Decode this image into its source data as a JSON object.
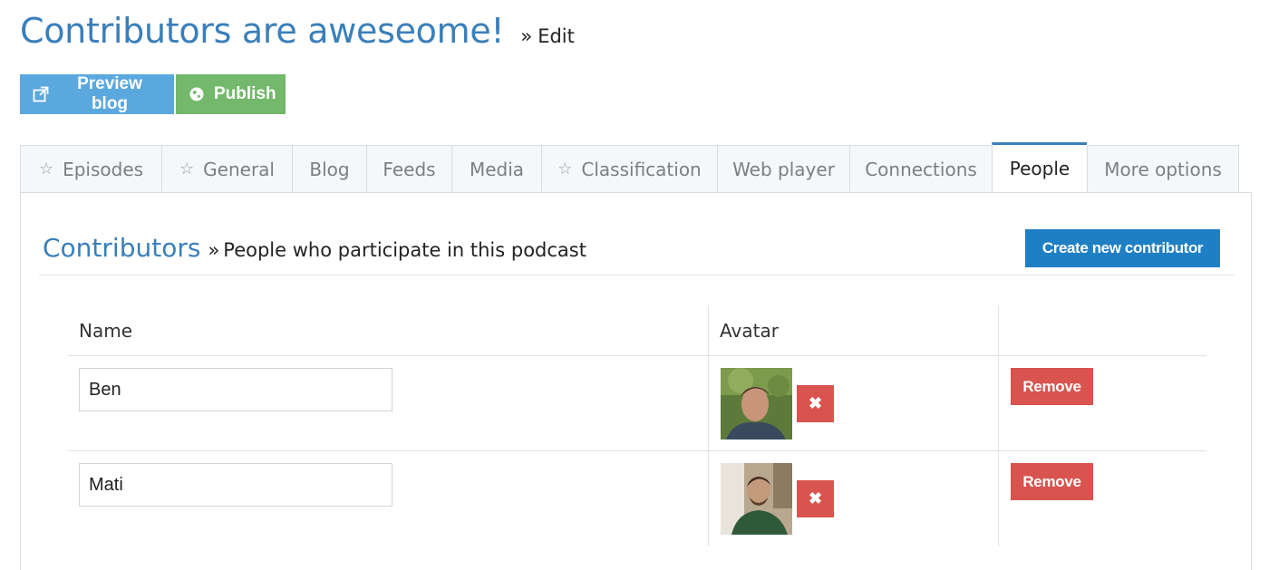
{
  "header": {
    "title": "Contributors are aweseome!",
    "separator": "»",
    "edit_label": "Edit"
  },
  "actions": {
    "preview_label": "Preview blog",
    "publish_label": "Publish"
  },
  "tabs": [
    {
      "label": "Episodes",
      "starred": true,
      "active": false
    },
    {
      "label": "General",
      "starred": true,
      "active": false
    },
    {
      "label": "Blog",
      "starred": false,
      "active": false
    },
    {
      "label": "Feeds",
      "starred": false,
      "active": false
    },
    {
      "label": "Media",
      "starred": false,
      "active": false
    },
    {
      "label": "Classification",
      "starred": true,
      "active": false
    },
    {
      "label": "Web player",
      "starred": false,
      "active": false
    },
    {
      "label": "Connections",
      "starred": false,
      "active": false
    },
    {
      "label": "People",
      "starred": false,
      "active": true
    },
    {
      "label": "More options",
      "starred": false,
      "active": false
    }
  ],
  "section": {
    "title": "Contributors",
    "separator": "»",
    "subtitle": "People who participate in this podcast",
    "create_label": "Create new contributor"
  },
  "table": {
    "columns": [
      "Name",
      "Avatar",
      ""
    ],
    "rows": [
      {
        "name": "Ben",
        "remove_label": "Remove",
        "clear_avatar_label": "✖"
      },
      {
        "name": "Mati",
        "remove_label": "Remove",
        "clear_avatar_label": "✖"
      }
    ]
  },
  "icons": {
    "preview": "external-link-icon",
    "publish": "globe-icon",
    "tab_star": "star-icon"
  },
  "colors": {
    "accent": "#3a7fba",
    "preview_button": "#5ba8de",
    "publish_button": "#73b86b",
    "create_button": "#1f7fc4",
    "danger": "#d9534f"
  }
}
